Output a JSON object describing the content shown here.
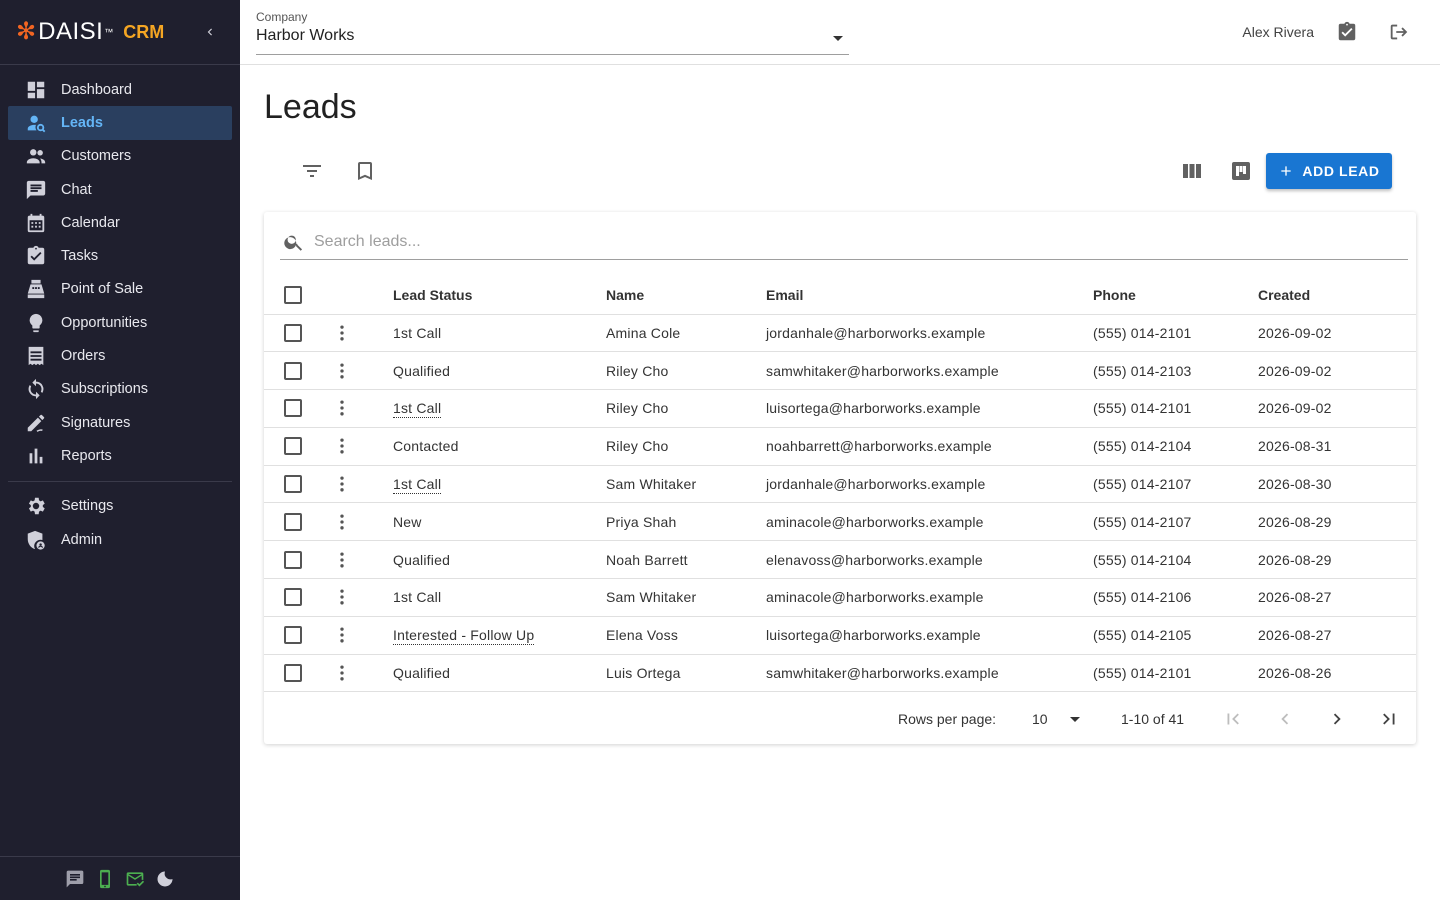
{
  "brand": {
    "name": "DAISI",
    "tm": "™",
    "product": "CRM"
  },
  "sidebar": {
    "items": [
      {
        "label": "Dashboard",
        "icon": "dashboard-icon"
      },
      {
        "label": "Leads",
        "icon": "leads-icon",
        "active": true
      },
      {
        "label": "Customers",
        "icon": "customers-icon"
      },
      {
        "label": "Chat",
        "icon": "chat-icon"
      },
      {
        "label": "Calendar",
        "icon": "calendar-icon"
      },
      {
        "label": "Tasks",
        "icon": "tasks-icon"
      },
      {
        "label": "Point of Sale",
        "icon": "point-of-sale-icon"
      },
      {
        "label": "Opportunities",
        "icon": "lightbulb-icon"
      },
      {
        "label": "Orders",
        "icon": "orders-icon"
      },
      {
        "label": "Subscriptions",
        "icon": "subscriptions-icon"
      },
      {
        "label": "Signatures",
        "icon": "signature-icon"
      },
      {
        "label": "Reports",
        "icon": "reports-icon"
      }
    ],
    "secondary": [
      {
        "label": "Settings",
        "icon": "gear-icon"
      },
      {
        "label": "Admin",
        "icon": "admin-icon"
      }
    ],
    "footer_icons": [
      "sms-icon",
      "phone-icon",
      "email-icon",
      "dark-mode-icon"
    ]
  },
  "header": {
    "company_label": "Company",
    "company_value": "Harbor Works",
    "user_name": "Alex Rivera"
  },
  "main": {
    "title": "Leads",
    "add_button": "ADD LEAD",
    "search_placeholder": "Search leads..."
  },
  "table": {
    "columns": [
      "Lead Status",
      "Name",
      "Email",
      "Phone",
      "Created"
    ],
    "rows": [
      {
        "status": "1st Call",
        "status_dotted": false,
        "name": "Amina Cole",
        "email": "jordanhale@harborworks.example",
        "phone": "(555) 014-2101",
        "created": "2026-09-02"
      },
      {
        "status": "Qualified",
        "status_dotted": false,
        "name": "Riley Cho",
        "email": "samwhitaker@harborworks.example",
        "phone": "(555) 014-2103",
        "created": "2026-09-02"
      },
      {
        "status": "1st Call",
        "status_dotted": true,
        "name": "Riley Cho",
        "email": "luisortega@harborworks.example",
        "phone": "(555) 014-2101",
        "created": "2026-09-02"
      },
      {
        "status": "Contacted",
        "status_dotted": false,
        "name": "Riley Cho",
        "email": "noahbarrett@harborworks.example",
        "phone": "(555) 014-2104",
        "created": "2026-08-31"
      },
      {
        "status": "1st Call",
        "status_dotted": true,
        "name": "Sam Whitaker",
        "email": "jordanhale@harborworks.example",
        "phone": "(555) 014-2107",
        "created": "2026-08-30"
      },
      {
        "status": "New",
        "status_dotted": false,
        "name": "Priya Shah",
        "email": "aminacole@harborworks.example",
        "phone": "(555) 014-2107",
        "created": "2026-08-29"
      },
      {
        "status": "Qualified",
        "status_dotted": false,
        "name": "Noah Barrett",
        "email": "elenavoss@harborworks.example",
        "phone": "(555) 014-2104",
        "created": "2026-08-29"
      },
      {
        "status": "1st Call",
        "status_dotted": false,
        "name": "Sam Whitaker",
        "email": "aminacole@harborworks.example",
        "phone": "(555) 014-2106",
        "created": "2026-08-27"
      },
      {
        "status": "Interested - Follow Up",
        "status_dotted": true,
        "name": "Elena Voss",
        "email": "luisortega@harborworks.example",
        "phone": "(555) 014-2105",
        "created": "2026-08-27"
      },
      {
        "status": "Qualified",
        "status_dotted": false,
        "name": "Luis Ortega",
        "email": "samwhitaker@harborworks.example",
        "phone": "(555) 014-2101",
        "created": "2026-08-26"
      }
    ]
  },
  "pagination": {
    "rows_per_page_label": "Rows per page:",
    "rows_per_page": "10",
    "range": "1-10 of 41"
  },
  "colors": {
    "sidebar_bg": "#1f1f2e",
    "active_bg": "#2a3f5f",
    "active_text": "#64b5f6",
    "accent": "#1976d2",
    "brand_orange": "#f26522",
    "crm_orange": "#f5a623",
    "footer_green": "#4caf50"
  }
}
